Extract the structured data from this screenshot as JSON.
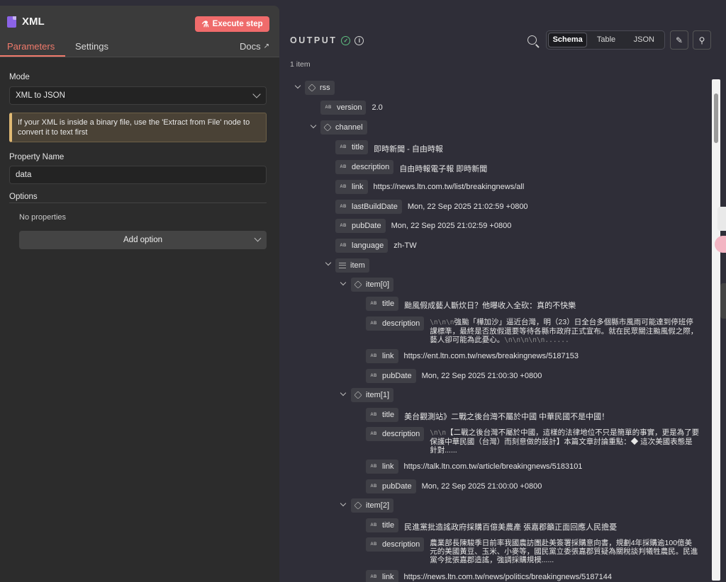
{
  "node": {
    "title": "XML",
    "execute_label": "Execute step"
  },
  "tabs": {
    "parameters": "Parameters",
    "settings": "Settings",
    "docs": "Docs"
  },
  "form": {
    "mode_label": "Mode",
    "mode_value": "XML to JSON",
    "notice": "If your XML is inside a binary file, use the 'Extract from File' node to convert it to text first",
    "property_label": "Property Name",
    "property_value": "data",
    "options_label": "Options",
    "no_properties": "No properties",
    "add_option": "Add option"
  },
  "output": {
    "title": "OUTPUT",
    "item_count": "1 item",
    "views": [
      "Schema",
      "Table",
      "JSON"
    ],
    "active_view": "Schema"
  },
  "tree": {
    "rss": "rss",
    "version": {
      "key": "version",
      "value": "2.0"
    },
    "channel": "channel",
    "channel_fields": [
      {
        "key": "title",
        "value": "即時新聞 - 自由時報"
      },
      {
        "key": "description",
        "value": "自由時報電子報 即時新聞"
      },
      {
        "key": "link",
        "value": "https://news.ltn.com.tw/list/breakingnews/all"
      },
      {
        "key": "lastBuildDate",
        "value": "Mon, 22 Sep 2025 21:02:59 +0800"
      },
      {
        "key": "pubDate",
        "value": "Mon, 22 Sep 2025 21:02:59 +0800"
      },
      {
        "key": "language",
        "value": "zh-TW"
      }
    ],
    "item": "item",
    "items": [
      {
        "label": "item[0]",
        "title": "颱風假成藝人斷炊日？他曝收入全砍：真的不快樂",
        "desc_prefix": "\\n\\n\\n",
        "description": "強颱「樺加沙」逼近台灣，明（23）日全台多個縣市風雨可能達到停班停課標準，最終是否放假還要等待各縣市政府正式宣布。就在民眾關注颱風假之際，藝人卻可能為此憂心。",
        "desc_suffix": "\\n\\n\\n\\n\\n......",
        "link": "https://ent.ltn.com.tw/news/breakingnews/5187153",
        "pubDate": "Mon, 22 Sep 2025 21:00:30 +0800"
      },
      {
        "label": "item[1]",
        "title": "美台觀測站》二戰之後台灣不屬於中國 中華民國不是中國！",
        "desc_prefix": "\\n\\n",
        "description": "【二戰之後台灣不屬於中國，這樣的法律地位不只是簡單的事實，更是為了要保護中華民國（台灣）而刻意做的設計】本篇文章討論重點：◆ 這次美國表態是針對......",
        "desc_suffix": "",
        "link": "https://talk.ltn.com.tw/article/breakingnews/5183101",
        "pubDate": "Mon, 22 Sep 2025 21:00:00 +0800"
      },
      {
        "label": "item[2]",
        "title": "民進黨批造謠政府採購百億美農產 張嘉郡籲正面回應人民擔憂",
        "desc_prefix": "",
        "description": "農業部長陳駿季日前率我國農訪團赴美簽署採購意向書，規劃4年採購逾100億美元的美國黃豆、玉米、小麥等，國民黨立委張嘉郡質疑為關稅談判犧牲農民。民進黨今批張嘉郡造謠，強調採購規模......",
        "desc_suffix": "",
        "link": "https://news.ltn.com.tw/news/politics/breakingnews/5187144",
        "pubDate": ""
      }
    ],
    "keys": {
      "title": "title",
      "description": "description",
      "link": "link",
      "pubDate": "pubDate"
    }
  },
  "icons": {
    "type_string": "AB",
    "accent": "#ef6b6b",
    "success": "#5fbf80"
  }
}
